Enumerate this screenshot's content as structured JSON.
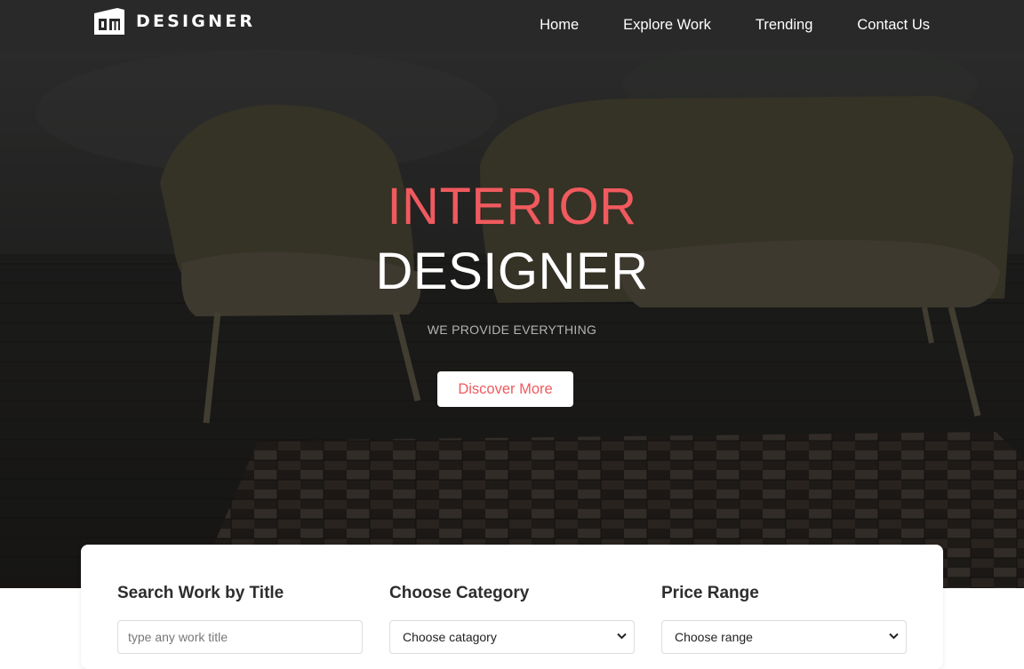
{
  "brand": {
    "logo_text": "DESIGNER",
    "logo_icon": "dm-logo-icon"
  },
  "nav": {
    "items": [
      "Home",
      "Explore Work",
      "Trending",
      "Contact Us"
    ]
  },
  "hero": {
    "title_line1": "INTERIOR",
    "title_line2": "DESIGNER",
    "subtitle": "WE PROVIDE EVERYTHING",
    "cta_label": "Discover More",
    "background_image": "two-armchairs-on-wooden-floor-with-patchwork-rug"
  },
  "search": {
    "title_label": "Search Work by Title",
    "title_placeholder": "type any work title",
    "category_label": "Choose Category",
    "category_value": "Choose catagory",
    "price_label": "Price Range",
    "price_value": "Choose range"
  },
  "colors": {
    "navbar": "#292929",
    "accent": "#f05a5e",
    "hero_text": "#ffffff",
    "card_background": "#ffffff"
  }
}
